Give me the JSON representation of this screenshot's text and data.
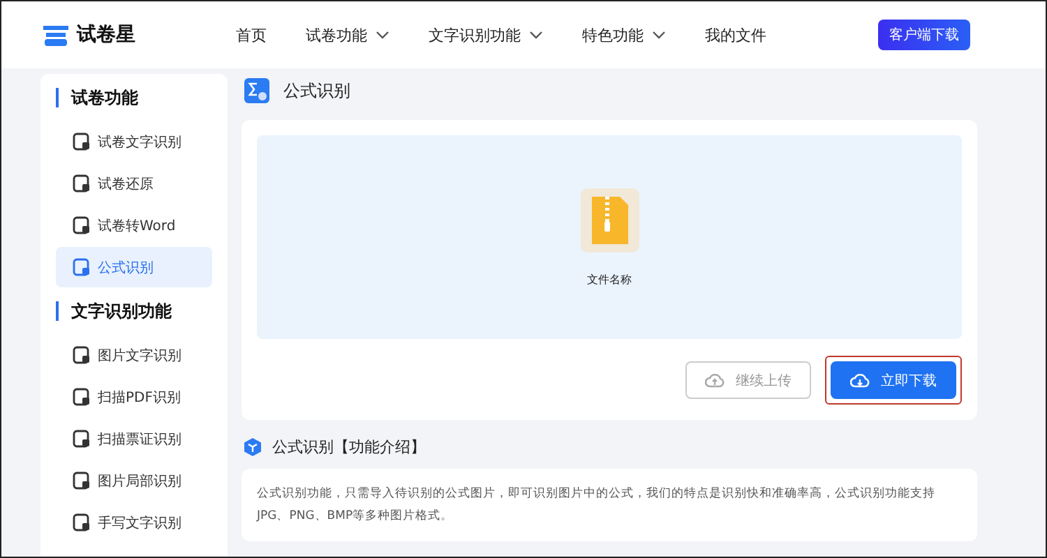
{
  "header": {
    "logo_text": "试卷星",
    "nav": [
      {
        "label": "首页",
        "kind": "link"
      },
      {
        "label": "试卷功能",
        "kind": "dropdown"
      },
      {
        "label": "文字识别功能",
        "kind": "dropdown"
      },
      {
        "label": "特色功能",
        "kind": "dropdown"
      },
      {
        "label": "我的文件",
        "kind": "link"
      }
    ],
    "download_button": "客户端下载"
  },
  "sidebar": {
    "groups": [
      {
        "title": "试卷功能",
        "items": [
          {
            "label": "试卷文字识别",
            "selected": false
          },
          {
            "label": "试卷还原",
            "selected": false
          },
          {
            "label": "试卷转Word",
            "selected": false
          },
          {
            "label": "公式识别",
            "selected": true
          }
        ]
      },
      {
        "title": "文字识别功能",
        "items": [
          {
            "label": "图片文字识别",
            "selected": false
          },
          {
            "label": "扫描PDF识别",
            "selected": false
          },
          {
            "label": "扫描票证识别",
            "selected": false
          },
          {
            "label": "图片局部识别",
            "selected": false
          },
          {
            "label": "手写文字识别",
            "selected": false
          }
        ]
      }
    ]
  },
  "main": {
    "title": "公式识别",
    "file": {
      "name": "文件名称"
    },
    "buttons": [
      {
        "label": "继续上传",
        "kind": "secondary"
      },
      {
        "label": "立即下载",
        "kind": "primary"
      }
    ],
    "intro": {
      "heading": "公式识别【功能介绍】",
      "text": "公式识别功能，只需导入待识别的公式图片，即可识别图片中的公式，我们的特点是识别快和准确率高，公式识别功能支持JPG、PNG、BMP等多种图片格式。"
    }
  }
}
